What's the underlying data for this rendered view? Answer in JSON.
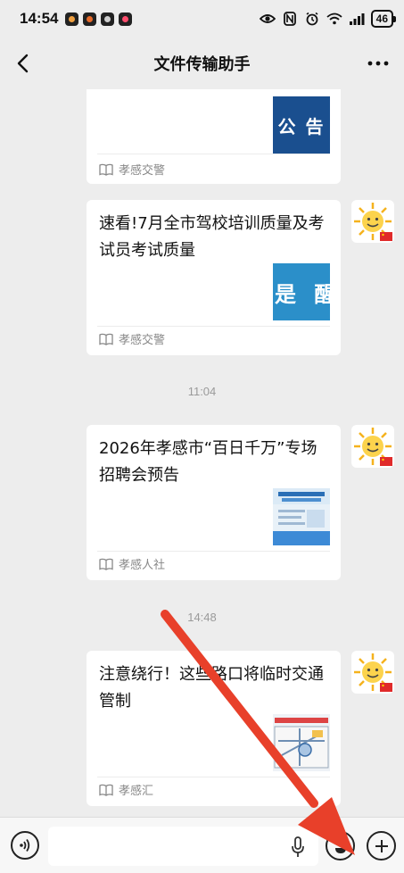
{
  "status_bar": {
    "time": "14:54",
    "battery": "46",
    "icons": [
      "eye-icon",
      "nfc-icon",
      "alarm-icon",
      "wifi-icon",
      "signal-icon",
      "battery-icon"
    ]
  },
  "header": {
    "title": "文件传输助手",
    "back_icon": "chevron-left-icon",
    "more_icon": "more-dots-icon"
  },
  "messages": [
    {
      "title": "",
      "thumb_text": "公 告",
      "source": "孝感交警"
    },
    {
      "title": "速看!7月全市驾校培训质量及考试员考试质量",
      "thumb_text": "是 醒",
      "source": "孝感交警"
    },
    {
      "time": "11:04"
    },
    {
      "title": "2026年孝感市“百日千万”专场招聘会预告",
      "thumb_text": "",
      "source": "孝感人社"
    },
    {
      "time": "14:48"
    },
    {
      "title": "注意绕行！这些路口将临时交通管制",
      "thumb_text": "",
      "source": "孝感汇"
    }
  ],
  "input_bar": {
    "placeholder": "",
    "icons": [
      "voice-icon",
      "mic-icon",
      "emoji-icon",
      "plus-icon"
    ]
  },
  "colors": {
    "background": "#ededed",
    "card": "#ffffff",
    "annotation_arrow": "#e8402a",
    "notice_thumb": "#1a4f8f",
    "remind_thumb": "#2b8fc9"
  }
}
